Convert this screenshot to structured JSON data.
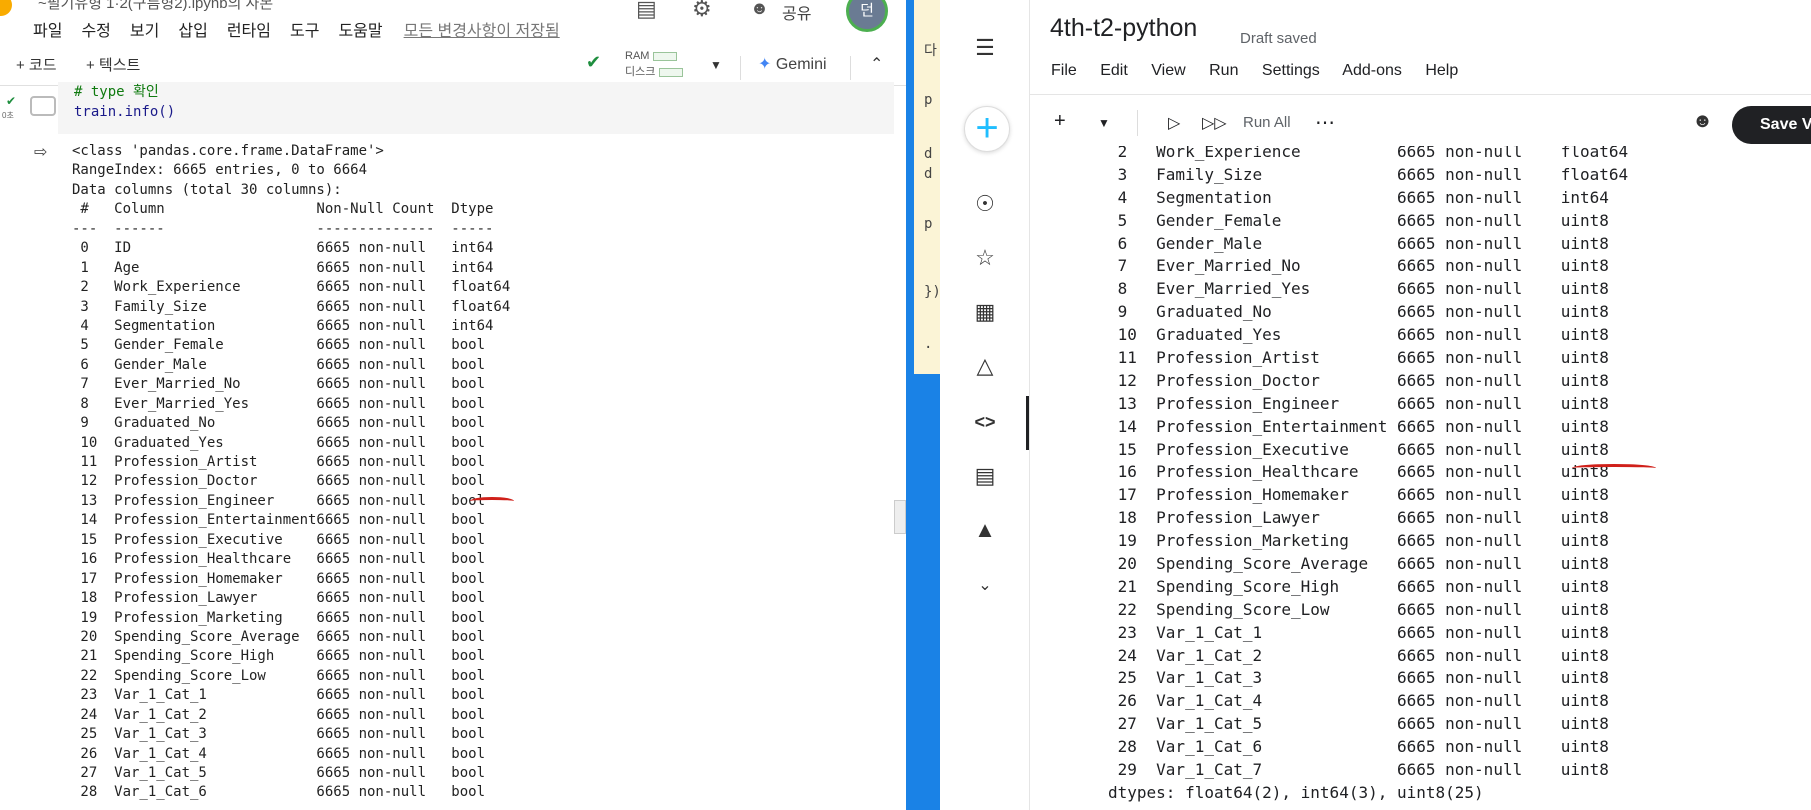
{
  "colab": {
    "title_fragment": "~필기유형 1·2(구름형2).ipynb의 사본",
    "menu": [
      "파일",
      "수정",
      "보기",
      "삽입",
      "런타임",
      "도구",
      "도움말"
    ],
    "saved_status": "모든 변경사항이 저장됨",
    "share_label": "공유",
    "avatar_letter": "던",
    "toolbar": {
      "add_code": "+ 코드",
      "add_text": "+ 텍스트",
      "ram_label": "RAM",
      "disk_label": "디스크",
      "gemini_label": "Gemini"
    },
    "cell": {
      "comment": "# type 확인",
      "code": "train.info()",
      "exec_time": "0초"
    },
    "output_header": [
      "<class 'pandas.core.frame.DataFrame'>",
      "RangeIndex: 6665 entries, 0 to 6664",
      "Data columns (total 30 columns):",
      " #   Column                  Non-Null Count  Dtype  ",
      "---  ------                  --------------  -----  "
    ],
    "columns": [
      {
        "idx": "0",
        "name": "ID",
        "count": "6665 non-null",
        "dtype": "int64"
      },
      {
        "idx": "1",
        "name": "Age",
        "count": "6665 non-null",
        "dtype": "int64"
      },
      {
        "idx": "2",
        "name": "Work_Experience",
        "count": "6665 non-null",
        "dtype": "float64"
      },
      {
        "idx": "3",
        "name": "Family_Size",
        "count": "6665 non-null",
        "dtype": "float64"
      },
      {
        "idx": "4",
        "name": "Segmentation",
        "count": "6665 non-null",
        "dtype": "int64"
      },
      {
        "idx": "5",
        "name": "Gender_Female",
        "count": "6665 non-null",
        "dtype": "bool"
      },
      {
        "idx": "6",
        "name": "Gender_Male",
        "count": "6665 non-null",
        "dtype": "bool"
      },
      {
        "idx": "7",
        "name": "Ever_Married_No",
        "count": "6665 non-null",
        "dtype": "bool"
      },
      {
        "idx": "8",
        "name": "Ever_Married_Yes",
        "count": "6665 non-null",
        "dtype": "bool"
      },
      {
        "idx": "9",
        "name": "Graduated_No",
        "count": "6665 non-null",
        "dtype": "bool"
      },
      {
        "idx": "10",
        "name": "Graduated_Yes",
        "count": "6665 non-null",
        "dtype": "bool"
      },
      {
        "idx": "11",
        "name": "Profession_Artist",
        "count": "6665 non-null",
        "dtype": "bool"
      },
      {
        "idx": "12",
        "name": "Profession_Doctor",
        "count": "6665 non-null",
        "dtype": "bool"
      },
      {
        "idx": "13",
        "name": "Profession_Engineer",
        "count": "6665 non-null",
        "dtype": "bool"
      },
      {
        "idx": "14",
        "name": "Profession_Entertainment",
        "count": "6665 non-null",
        "dtype": "bool"
      },
      {
        "idx": "15",
        "name": "Profession_Executive",
        "count": "6665 non-null",
        "dtype": "bool"
      },
      {
        "idx": "16",
        "name": "Profession_Healthcare",
        "count": "6665 non-null",
        "dtype": "bool"
      },
      {
        "idx": "17",
        "name": "Profession_Homemaker",
        "count": "6665 non-null",
        "dtype": "bool"
      },
      {
        "idx": "18",
        "name": "Profession_Lawyer",
        "count": "6665 non-null",
        "dtype": "bool"
      },
      {
        "idx": "19",
        "name": "Profession_Marketing",
        "count": "6665 non-null",
        "dtype": "bool"
      },
      {
        "idx": "20",
        "name": "Spending_Score_Average",
        "count": "6665 non-null",
        "dtype": "bool"
      },
      {
        "idx": "21",
        "name": "Spending_Score_High",
        "count": "6665 non-null",
        "dtype": "bool"
      },
      {
        "idx": "22",
        "name": "Spending_Score_Low",
        "count": "6665 non-null",
        "dtype": "bool"
      },
      {
        "idx": "23",
        "name": "Var_1_Cat_1",
        "count": "6665 non-null",
        "dtype": "bool"
      },
      {
        "idx": "24",
        "name": "Var_1_Cat_2",
        "count": "6665 non-null",
        "dtype": "bool"
      },
      {
        "idx": "25",
        "name": "Var_1_Cat_3",
        "count": "6665 non-null",
        "dtype": "bool"
      },
      {
        "idx": "26",
        "name": "Var_1_Cat_4",
        "count": "6665 non-null",
        "dtype": "bool"
      },
      {
        "idx": "27",
        "name": "Var_1_Cat_5",
        "count": "6665 non-null",
        "dtype": "bool"
      },
      {
        "idx": "28",
        "name": "Var_1_Cat_6",
        "count": "6665 non-null",
        "dtype": "bool"
      }
    ]
  },
  "peek_chars": [
    "다",
    "p",
    "d",
    "d",
    "p",
    "})",
    "."
  ],
  "kaggle": {
    "title": "4th-t2-python",
    "draft_status": "Draft saved",
    "menu": [
      "File",
      "Edit",
      "View",
      "Run",
      "Settings",
      "Add-ons",
      "Help"
    ],
    "run_all_label": "Run All",
    "save_label": "Save V",
    "columns": [
      {
        "idx": "2",
        "name": "Work_Experience",
        "count": "6665 non-null",
        "dtype": "float64"
      },
      {
        "idx": "3",
        "name": "Family_Size",
        "count": "6665 non-null",
        "dtype": "float64"
      },
      {
        "idx": "4",
        "name": "Segmentation",
        "count": "6665 non-null",
        "dtype": "int64"
      },
      {
        "idx": "5",
        "name": "Gender_Female",
        "count": "6665 non-null",
        "dtype": "uint8"
      },
      {
        "idx": "6",
        "name": "Gender_Male",
        "count": "6665 non-null",
        "dtype": "uint8"
      },
      {
        "idx": "7",
        "name": "Ever_Married_No",
        "count": "6665 non-null",
        "dtype": "uint8"
      },
      {
        "idx": "8",
        "name": "Ever_Married_Yes",
        "count": "6665 non-null",
        "dtype": "uint8"
      },
      {
        "idx": "9",
        "name": "Graduated_No",
        "count": "6665 non-null",
        "dtype": "uint8"
      },
      {
        "idx": "10",
        "name": "Graduated_Yes",
        "count": "6665 non-null",
        "dtype": "uint8"
      },
      {
        "idx": "11",
        "name": "Profession_Artist",
        "count": "6665 non-null",
        "dtype": "uint8"
      },
      {
        "idx": "12",
        "name": "Profession_Doctor",
        "count": "6665 non-null",
        "dtype": "uint8"
      },
      {
        "idx": "13",
        "name": "Profession_Engineer",
        "count": "6665 non-null",
        "dtype": "uint8"
      },
      {
        "idx": "14",
        "name": "Profession_Entertainment",
        "count": "6665 non-null",
        "dtype": "uint8"
      },
      {
        "idx": "15",
        "name": "Profession_Executive",
        "count": "6665 non-null",
        "dtype": "uint8"
      },
      {
        "idx": "16",
        "name": "Profession_Healthcare",
        "count": "6665 non-null",
        "dtype": "uint8"
      },
      {
        "idx": "17",
        "name": "Profession_Homemaker",
        "count": "6665 non-null",
        "dtype": "uint8"
      },
      {
        "idx": "18",
        "name": "Profession_Lawyer",
        "count": "6665 non-null",
        "dtype": "uint8"
      },
      {
        "idx": "19",
        "name": "Profession_Marketing",
        "count": "6665 non-null",
        "dtype": "uint8"
      },
      {
        "idx": "20",
        "name": "Spending_Score_Average",
        "count": "6665 non-null",
        "dtype": "uint8"
      },
      {
        "idx": "21",
        "name": "Spending_Score_High",
        "count": "6665 non-null",
        "dtype": "uint8"
      },
      {
        "idx": "22",
        "name": "Spending_Score_Low",
        "count": "6665 non-null",
        "dtype": "uint8"
      },
      {
        "idx": "23",
        "name": "Var_1_Cat_1",
        "count": "6665 non-null",
        "dtype": "uint8"
      },
      {
        "idx": "24",
        "name": "Var_1_Cat_2",
        "count": "6665 non-null",
        "dtype": "uint8"
      },
      {
        "idx": "25",
        "name": "Var_1_Cat_3",
        "count": "6665 non-null",
        "dtype": "uint8"
      },
      {
        "idx": "26",
        "name": "Var_1_Cat_4",
        "count": "6665 non-null",
        "dtype": "uint8"
      },
      {
        "idx": "27",
        "name": "Var_1_Cat_5",
        "count": "6665 non-null",
        "dtype": "uint8"
      },
      {
        "idx": "28",
        "name": "Var_1_Cat_6",
        "count": "6665 non-null",
        "dtype": "uint8"
      },
      {
        "idx": "29",
        "name": "Var_1_Cat_7",
        "count": "6665 non-null",
        "dtype": "uint8"
      }
    ],
    "dtypes_summary": "dtypes: float64(2), int64(3), uint8(25)"
  },
  "colors": {
    "annotation_red": "#d0201a",
    "kaggle_accent": "#20beff",
    "divider_blue": "#1a82e6"
  }
}
